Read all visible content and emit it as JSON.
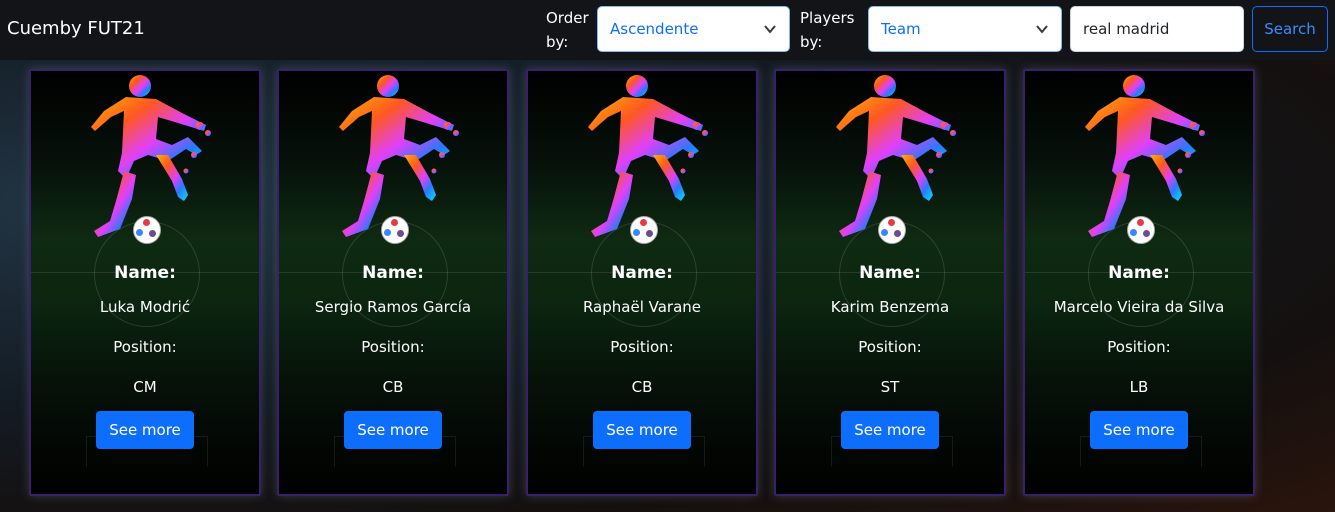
{
  "app": {
    "title": "Cuemby FUT21"
  },
  "filters": {
    "order_label": "Order by:",
    "order_value": "Ascendente",
    "players_label": "Players by:",
    "players_value": "Team",
    "search_value": "real madrid",
    "search_button": "Search"
  },
  "card_labels": {
    "name": "Name:",
    "position": "Position:",
    "button": "See more"
  },
  "players": [
    {
      "name": "Luka Modrić",
      "position": "CM"
    },
    {
      "name": "Sergio Ramos García",
      "position": "CB"
    },
    {
      "name": "Raphaël Varane",
      "position": "CB"
    },
    {
      "name": "Karim Benzema",
      "position": "ST"
    },
    {
      "name": "Marcelo Vieira da Silva",
      "position": "LB"
    }
  ],
  "colors": {
    "primary": "#0d6efd",
    "card_border": "#3a1f6b",
    "navbar": "#121418"
  },
  "icons": {
    "player_image": "soccer-player-silhouette-icon",
    "ball": "soccer-ball-icon",
    "select_arrow": "chevron-down-icon"
  }
}
